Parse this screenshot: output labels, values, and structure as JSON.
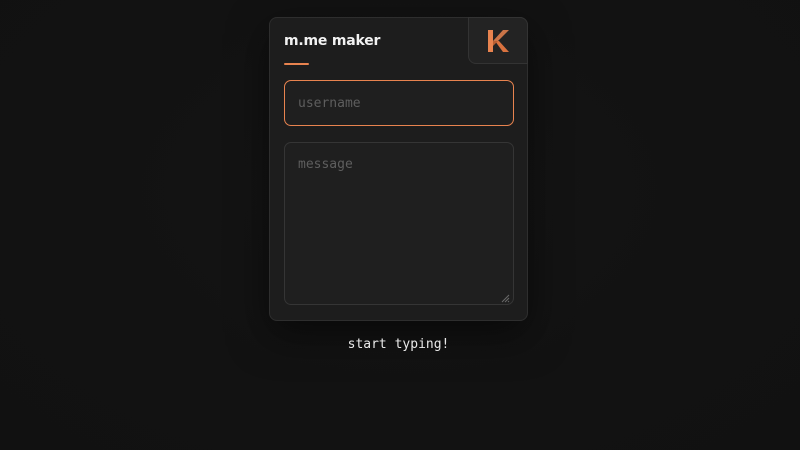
{
  "app": {
    "title": "m.me maker",
    "logo_icon": "k-logo-icon"
  },
  "form": {
    "username_placeholder": "username",
    "username_value": "",
    "message_placeholder": "message",
    "message_value": ""
  },
  "status": {
    "text": "start typing!"
  },
  "colors": {
    "accent": "#e8834f",
    "background": "#121212",
    "card": "#1d1d1d"
  }
}
